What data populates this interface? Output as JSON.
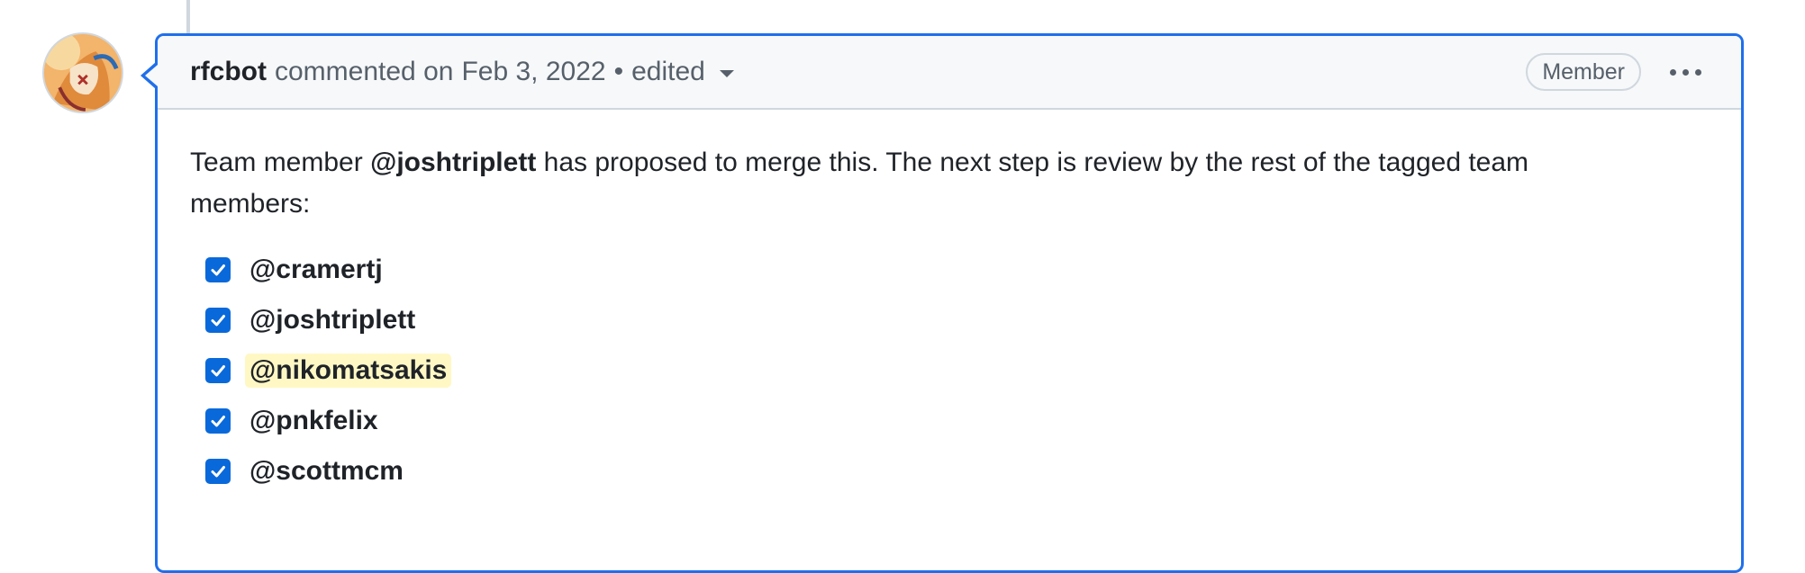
{
  "comment": {
    "author": "rfcbot",
    "action": "commented on",
    "date": "Feb 3, 2022",
    "separator": "•",
    "edited_label": "edited",
    "role_badge": "Member",
    "body": {
      "part1": "Team member ",
      "proposer": "@joshtriplett",
      "part2": " has proposed to merge this. The next step is review by the rest of the tagged team members:"
    },
    "checklist": [
      {
        "label": "@cramertj",
        "checked": true,
        "highlight": false
      },
      {
        "label": "@joshtriplett",
        "checked": true,
        "highlight": false
      },
      {
        "label": "@nikomatsakis",
        "checked": true,
        "highlight": true
      },
      {
        "label": "@pnkfelix",
        "checked": true,
        "highlight": false
      },
      {
        "label": "@scottmcm",
        "checked": true,
        "highlight": false
      }
    ]
  },
  "colors": {
    "accent": "#1f6feb",
    "checkbox": "#0969da",
    "highlight": "#fff8c5",
    "muted_text": "#57606a"
  },
  "icons": {
    "avatar": "avatar-image",
    "edited_caret": "chevron-down-icon",
    "more": "kebab-horizontal-icon",
    "checkbox": "checkmark-icon"
  }
}
